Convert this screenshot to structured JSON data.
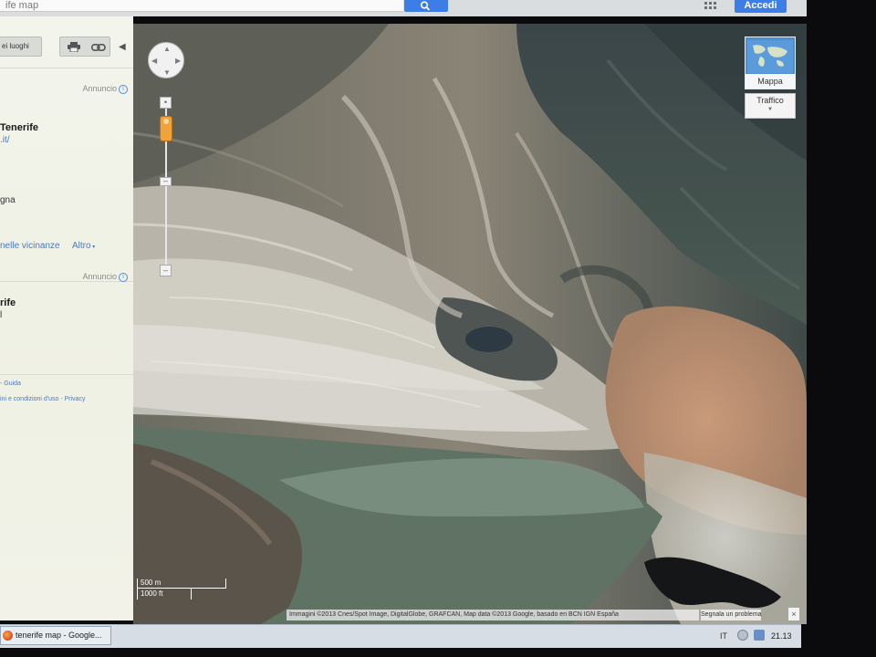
{
  "topbar": {
    "search_value": "ife map",
    "signin_label": "Accedi",
    "search_icon": "search-icon",
    "apps_icon": "apps-grid-icon",
    "accent": "#3d7de8"
  },
  "panel": {
    "nearby_label": "ei luoghi",
    "print_icon": "print-icon",
    "link_icon": "link-icon",
    "collapse_icon": "chevron-left-icon",
    "ad1": {
      "label": "Annuncio",
      "title": "Tenerife",
      "url": ".it/",
      "text": "gna"
    },
    "nearby_search": "nelle vicinanze",
    "more": "Altro",
    "ad2": {
      "label": "Annuncio",
      "title": "rife",
      "text": "l"
    },
    "footer1": "- Guida",
    "footer2": "ini e condizioni d'uso - Privacy"
  },
  "map": {
    "type_label": "Mappa",
    "traffic_label": "Traffico",
    "scale_metric": "500 m",
    "scale_imperial": "1000 ft",
    "attribution": "Immagini ©2013 Cnes/Spot Image, DigitalGlobe, GRAFCAN, Map data ©2013 Google, basado en BCN IGN España",
    "report_label": "Segnala un problema",
    "close_label": "×",
    "pan_icon": "pan-control-icon",
    "pegman_icon": "pegman-icon"
  },
  "taskbar": {
    "window_title": "tenerife map - Google...",
    "browser_icon": "firefox-icon",
    "lang": "IT",
    "clock": "21.13"
  }
}
